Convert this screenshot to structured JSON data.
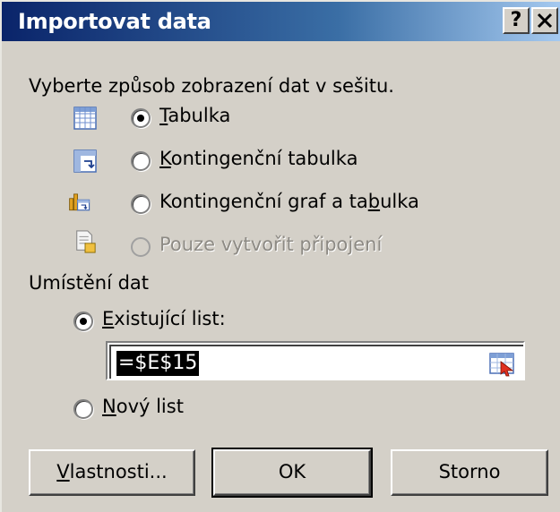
{
  "window": {
    "title": "Importovat data",
    "help_label": "?",
    "close_label": "✕"
  },
  "view": {
    "prompt": "Vyberte způsob zobrazení dat v sešitu.",
    "options": [
      {
        "label_pre": "",
        "label_u": "T",
        "label_post": "abulka",
        "selected": true,
        "enabled": true,
        "icon": "table-icon"
      },
      {
        "label_pre": "",
        "label_u": "K",
        "label_post": "ontingenční tabulka",
        "selected": false,
        "enabled": true,
        "icon": "pivot-table-icon"
      },
      {
        "label_pre": "Kontingenční graf a ta",
        "label_u": "b",
        "label_post": "ulka",
        "selected": false,
        "enabled": true,
        "icon": "pivot-chart-icon"
      },
      {
        "label_pre": "",
        "label_u": "",
        "label_post": "Pouze vytvořit připojení",
        "selected": false,
        "enabled": false,
        "icon": "connection-only-icon"
      }
    ]
  },
  "location": {
    "heading": "Umístění dat",
    "existing": {
      "label_pre": "",
      "label_u": "E",
      "label_post": "xistující list:",
      "selected": true
    },
    "range_value": "=$E$15",
    "new_sheet": {
      "label_pre": "",
      "label_u": "N",
      "label_post": "ový list",
      "selected": false
    }
  },
  "buttons": {
    "properties": {
      "label_pre": "",
      "label_u": "V",
      "label_post": "lastnosti..."
    },
    "ok": "OK",
    "cancel": "Storno"
  }
}
